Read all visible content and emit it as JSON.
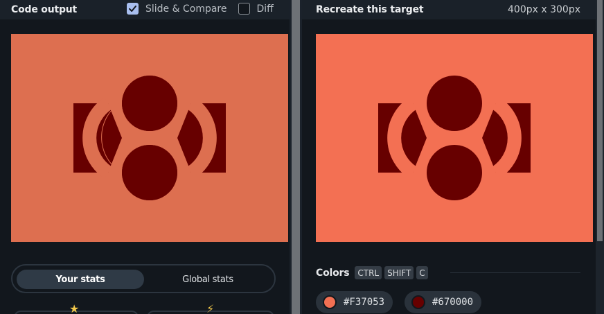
{
  "left_panel": {
    "title": "Code output",
    "slide_compare": {
      "label": "Slide & Compare",
      "checked": true
    },
    "diff": {
      "label": "Diff",
      "checked": false
    },
    "stats_tabs": {
      "active": "Your stats",
      "inactive": "Global stats"
    },
    "stat_icons": [
      "star-icon",
      "lightning-icon"
    ]
  },
  "right_panel": {
    "title": "Recreate this target",
    "dimensions": "400px x 300px",
    "colors": {
      "label": "Colors",
      "shortcut_keys": [
        "CTRL",
        "SHIFT",
        "C"
      ],
      "swatches": [
        {
          "hex": "#F37053",
          "color": "#f37053"
        },
        {
          "hex": "#670000",
          "color": "#670000"
        }
      ]
    }
  },
  "colors": {
    "output_background": "#dd6f50",
    "target_background": "#f37053",
    "shape": "#670000",
    "checkbox_accent": "#a9bfef"
  }
}
